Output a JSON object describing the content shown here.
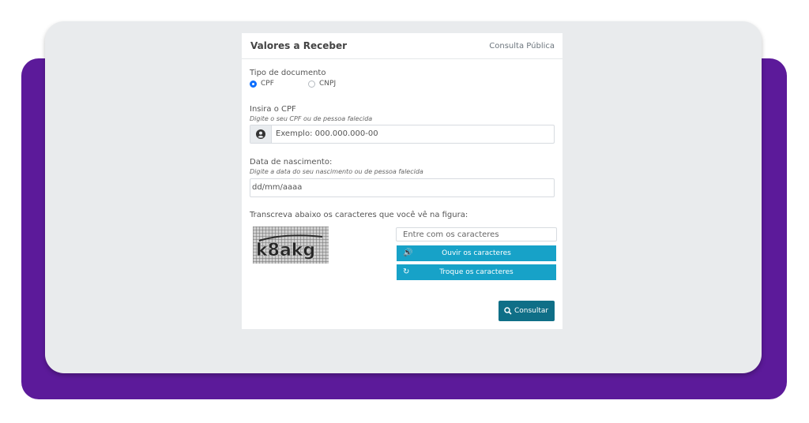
{
  "card": {
    "title": "Valores a Receber",
    "subtitle": "Consulta Pública"
  },
  "doc_type": {
    "label": "Tipo de documento",
    "options": [
      {
        "label": "CPF",
        "selected": true
      },
      {
        "label": "CNPJ",
        "selected": false
      }
    ]
  },
  "cpf": {
    "label": "Insira o CPF",
    "hint": "Digite o seu CPF ou de pessoa falecida",
    "placeholder": "Exemplo: 000.000.000-00",
    "icon": "user-icon"
  },
  "birth": {
    "label": "Data de nascimento:",
    "hint": "Digite a data do seu nascimento ou de pessoa falecida",
    "placeholder": "dd/mm/aaaa"
  },
  "captcha": {
    "label": "Transcreva abaixo os caracteres que você vê na figura:",
    "image_text": "k8akg",
    "input_placeholder": "Entre com os caracteres",
    "listen_label": "Ouvir os caracteres",
    "refresh_label": "Troque os caracteres"
  },
  "submit": {
    "label": "Consultar"
  },
  "colors": {
    "purple": "#5c1a9a",
    "accent": "#17a2c8",
    "submit": "#0f6f87",
    "radio": "#0d6efd"
  }
}
